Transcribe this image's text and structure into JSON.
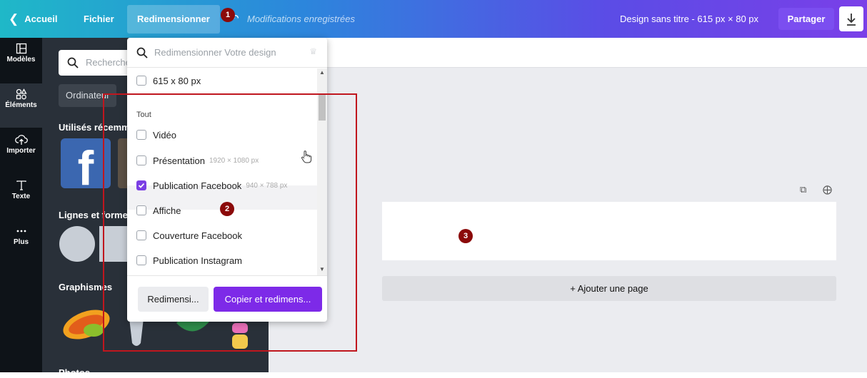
{
  "topbar": {
    "back_label": "Accueil",
    "file_label": "Fichier",
    "resize_label": "Redimensionner",
    "saved_label": "Modifications enregistrées",
    "design_title": "Design sans titre - 615 px × 80 px",
    "share_label": "Partager"
  },
  "rail": {
    "items": [
      {
        "label": "Modèles",
        "icon": "templates-icon"
      },
      {
        "label": "Éléments",
        "icon": "elements-icon"
      },
      {
        "label": "Importer",
        "icon": "upload-icon"
      },
      {
        "label": "Texte",
        "icon": "text-icon"
      },
      {
        "label": "Plus",
        "icon": "more-icon"
      }
    ]
  },
  "panel": {
    "search_placeholder": "Recherche",
    "chip_label": "Ordinateur",
    "recent_heading": "Utilisés récemm",
    "shapes_heading": "Lignes et forme",
    "graphics_heading": "Graphismes",
    "photos_heading": "Photos",
    "fb_letter": "f"
  },
  "dropdown": {
    "search_placeholder": "Redimensionner Votre design",
    "custom_size": "615 x 80 px",
    "section_label": "Tout",
    "options": [
      {
        "label": "Vidéo",
        "dims": "",
        "checked": false
      },
      {
        "label": "Présentation",
        "dims": "1920 × 1080 px",
        "checked": false
      },
      {
        "label": "Publication Facebook",
        "dims": "940 × 788 px",
        "checked": true
      },
      {
        "label": "Affiche",
        "dims": "",
        "checked": false
      },
      {
        "label": "Couverture Facebook",
        "dims": "",
        "checked": false
      },
      {
        "label": "Publication Instagram",
        "dims": "",
        "checked": false
      }
    ],
    "resize_button": "Redimensi...",
    "copy_button": "Copier et redimens..."
  },
  "canvas": {
    "add_page_label": "+ Ajouter une page"
  },
  "annotations": {
    "badge1": "1",
    "badge2": "2",
    "badge3": "3"
  }
}
